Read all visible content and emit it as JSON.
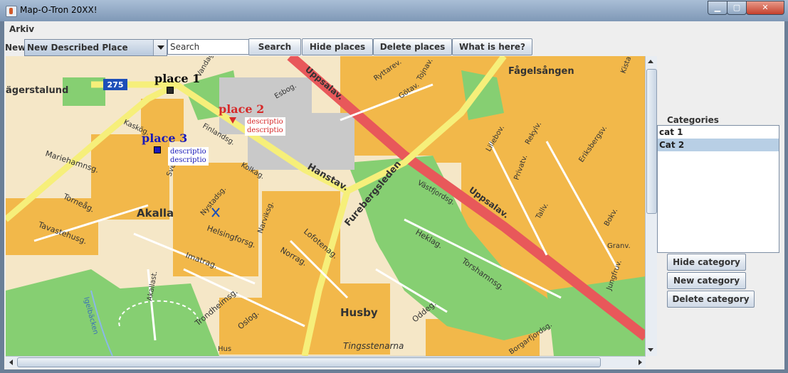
{
  "window": {
    "title": "Map-O-Tron 20XX!"
  },
  "menu": {
    "file_label": "Arkiv"
  },
  "toolbar": {
    "new_label": "New:",
    "type_value": "New Described Place",
    "search_value": "Search",
    "search_button": "Search",
    "hide_places_button": "Hide places",
    "delete_places_button": "Delete places",
    "what_is_here_button": "What is here?"
  },
  "map": {
    "places": [
      {
        "name": "place 1",
        "color": "#000000"
      },
      {
        "name": "place 2",
        "color": "#d62a2a",
        "description": [
          "descriptio",
          "descriptio"
        ]
      },
      {
        "name": "place 3",
        "color": "#1a1ab8",
        "description": [
          "descriptio",
          "descriptio"
        ]
      }
    ],
    "labels": {
      "road_275": "275",
      "agerstalund": "ägerstalund",
      "uppsalav_1": "Uppsalav.",
      "uppsalav_2": "Uppsalav.",
      "fagelsangen": "Fågelsången",
      "hanstav": "Hanstav.",
      "furebergsleden": "Furebergsleden",
      "akalla": "Akalla",
      "husby": "Husby",
      "tingsstenarna": "Tingsstenarna",
      "kolkag": "Kolkag.",
      "helsingforsg": "Helsingforsg.",
      "torneag": "Torneåg.",
      "tavastehusg": "Tavastehusg.",
      "mariehamnsg": "Mariehamnsg.",
      "imatrag": "Imatrag.",
      "norrag": "Norrag.",
      "lofotenag": "Lofotenag.",
      "narviksg": "Narviksg.",
      "heklag": "Heklag.",
      "torshamnsg": "Torshamnsg.",
      "vastfjordsg": "Västfjordsg.",
      "trondheimsg": "Trondheimsg.",
      "oslog": "Oslog.",
      "oddeg": "Oddeg.",
      "ryttarev": "Ryttarev.",
      "gotav": "Götav.",
      "tojnav": "Tojnav.",
      "esbog": "Esbog.",
      "finlandsg": "Finlandsg.",
      "nystadsg": "Nystadsg.",
      "vandag": "Vandag.",
      "kaskog": "Kaskög.",
      "sveabg": "Sveabg.",
      "akallast": "Akallast.",
      "igelbacken": "Igelbäcken",
      "lillebov": "Lillebov.",
      "rekylv": "Rekylv.",
      "privatv": "Privatv.",
      "eriksbergsv": "Eriksbergsv.",
      "tallv": "Tallv.",
      "bokv": "Bokv.",
      "granv": "Granv.",
      "hus": "Hus",
      "sorgarden": "Borgarfjordsg.",
      "jungfruv": "Jungfruv.",
      "nystad2": "Kista"
    }
  },
  "categories": {
    "label": "Categories",
    "items": [
      "cat 1",
      "Cat 2"
    ],
    "selected_index": 1,
    "hide_button": "Hide category",
    "new_button": "New category",
    "delete_button": "Delete category"
  },
  "colors": {
    "map_base": "#f5e7c7",
    "built_area": "#f2b84a",
    "green": "#86cf72",
    "main_road": "#e8585a",
    "road": "#f6ef7a",
    "selection": "#b8cfe5"
  }
}
